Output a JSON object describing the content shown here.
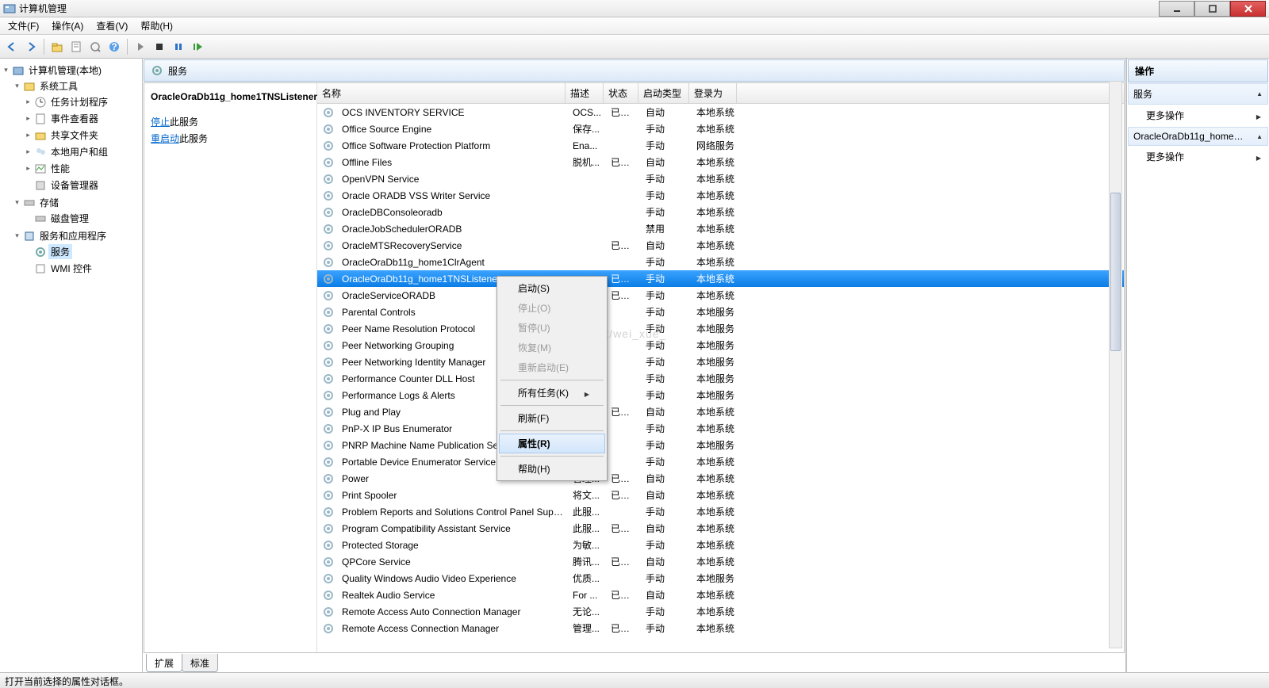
{
  "window": {
    "title": "计算机管理"
  },
  "menubar": [
    "文件(F)",
    "操作(A)",
    "查看(V)",
    "帮助(H)"
  ],
  "tree": {
    "root": "计算机管理(本地)",
    "systools": "系统工具",
    "task_sched": "任务计划程序",
    "event_viewer": "事件查看器",
    "shared": "共享文件夹",
    "local_users": "本地用户和组",
    "perf": "性能",
    "devmgr": "设备管理器",
    "storage": "存储",
    "diskmgmt": "磁盘管理",
    "services_apps": "服务和应用程序",
    "services": "服务",
    "wmi": "WMI 控件"
  },
  "center": {
    "title": "服务"
  },
  "detail": {
    "name": "OracleOraDb11g_home1TNSListener",
    "stop_pre": "停止",
    "stop_rest": "此服务",
    "restart_pre": "重启动",
    "restart_rest": "此服务"
  },
  "columns": {
    "name": "名称",
    "desc": "描述",
    "status": "状态",
    "startup": "启动类型",
    "logon": "登录为"
  },
  "rows": [
    {
      "name": "OCS INVENTORY SERVICE",
      "desc": "OCS...",
      "status": "已启动",
      "startup": "自动",
      "logon": "本地系统"
    },
    {
      "name": "Office  Source Engine",
      "desc": "保存...",
      "status": "",
      "startup": "手动",
      "logon": "本地系统"
    },
    {
      "name": "Office Software Protection Platform",
      "desc": "Ena...",
      "status": "",
      "startup": "手动",
      "logon": "网络服务"
    },
    {
      "name": "Offline Files",
      "desc": "脱机...",
      "status": "已启动",
      "startup": "自动",
      "logon": "本地系统"
    },
    {
      "name": "OpenVPN Service",
      "desc": "",
      "status": "",
      "startup": "手动",
      "logon": "本地系统"
    },
    {
      "name": "Oracle ORADB VSS Writer Service",
      "desc": "",
      "status": "",
      "startup": "手动",
      "logon": "本地系统"
    },
    {
      "name": "OracleDBConsoleoradb",
      "desc": "",
      "status": "",
      "startup": "手动",
      "logon": "本地系统"
    },
    {
      "name": "OracleJobSchedulerORADB",
      "desc": "",
      "status": "",
      "startup": "禁用",
      "logon": "本地系统"
    },
    {
      "name": "OracleMTSRecoveryService",
      "desc": "",
      "status": "已启动",
      "startup": "自动",
      "logon": "本地系统"
    },
    {
      "name": "OracleOraDb11g_home1ClrAgent",
      "desc": "",
      "status": "",
      "startup": "手动",
      "logon": "本地系统"
    },
    {
      "name": "OracleOraDb11g_home1TNSListener",
      "desc": "",
      "status": "已启动",
      "startup": "手动",
      "logon": "本地系统",
      "selected": true
    },
    {
      "name": "OracleServiceORADB",
      "desc": "",
      "status": "已启动",
      "startup": "手动",
      "logon": "本地系统"
    },
    {
      "name": "Parental Controls",
      "desc": "",
      "status": "",
      "startup": "手动",
      "logon": "本地服务"
    },
    {
      "name": "Peer Name Resolution Protocol",
      "desc": "",
      "status": "",
      "startup": "手动",
      "logon": "本地服务"
    },
    {
      "name": "Peer Networking Grouping",
      "desc": "",
      "status": "",
      "startup": "手动",
      "logon": "本地服务"
    },
    {
      "name": "Peer Networking Identity Manager",
      "desc": "",
      "status": "",
      "startup": "手动",
      "logon": "本地服务"
    },
    {
      "name": "Performance Counter DLL Host",
      "desc": "",
      "status": "",
      "startup": "手动",
      "logon": "本地服务"
    },
    {
      "name": "Performance Logs & Alerts",
      "desc": "",
      "status": "",
      "startup": "手动",
      "logon": "本地服务"
    },
    {
      "name": "Plug and Play",
      "desc": "",
      "status": "已启动",
      "startup": "自动",
      "logon": "本地系统"
    },
    {
      "name": "PnP-X IP Bus Enumerator",
      "desc": "",
      "status": "",
      "startup": "手动",
      "logon": "本地系统"
    },
    {
      "name": "PNRP Machine Name Publication Service",
      "desc": "",
      "status": "",
      "startup": "手动",
      "logon": "本地服务"
    },
    {
      "name": "Portable Device Enumerator Service",
      "desc": "",
      "status": "",
      "startup": "手动",
      "logon": "本地系统"
    },
    {
      "name": "Power",
      "desc": "管理...",
      "status": "已启动",
      "startup": "自动",
      "logon": "本地系统"
    },
    {
      "name": "Print Spooler",
      "desc": "将文...",
      "status": "已启动",
      "startup": "自动",
      "logon": "本地系统"
    },
    {
      "name": "Problem Reports and Solutions Control Panel Support",
      "desc": "此服...",
      "status": "",
      "startup": "手动",
      "logon": "本地系统"
    },
    {
      "name": "Program Compatibility Assistant Service",
      "desc": "此服...",
      "status": "已启动",
      "startup": "自动",
      "logon": "本地系统"
    },
    {
      "name": "Protected Storage",
      "desc": "为敏...",
      "status": "",
      "startup": "手动",
      "logon": "本地系统"
    },
    {
      "name": "QPCore Service",
      "desc": "腾讯...",
      "status": "已启动",
      "startup": "自动",
      "logon": "本地系统"
    },
    {
      "name": "Quality Windows Audio Video Experience",
      "desc": "优质...",
      "status": "",
      "startup": "手动",
      "logon": "本地服务"
    },
    {
      "name": "Realtek Audio Service",
      "desc": "For ...",
      "status": "已启动",
      "startup": "自动",
      "logon": "本地系统"
    },
    {
      "name": "Remote Access Auto Connection Manager",
      "desc": "无论...",
      "status": "",
      "startup": "手动",
      "logon": "本地系统"
    },
    {
      "name": "Remote Access Connection Manager",
      "desc": "管理...",
      "status": "已启动",
      "startup": "手动",
      "logon": "本地系统"
    }
  ],
  "tabs": {
    "extended": "扩展",
    "standard": "标准"
  },
  "actions": {
    "header": "操作",
    "services": "服务",
    "more_ops": "更多操作",
    "item_name": "OracleOraDb11g_home1...",
    "more_ops2": "更多操作"
  },
  "context_menu": {
    "start": "启动(S)",
    "stop": "停止(O)",
    "pause": "暂停(U)",
    "resume": "恢复(M)",
    "restart": "重新启动(E)",
    "all_tasks": "所有任务(K)",
    "refresh": "刷新(F)",
    "properties": "属性(R)",
    "help": "帮助(H)"
  },
  "statusbar": "打开当前选择的属性对话框。",
  "watermark": "http://blog.csdn.net/wei_xue_"
}
